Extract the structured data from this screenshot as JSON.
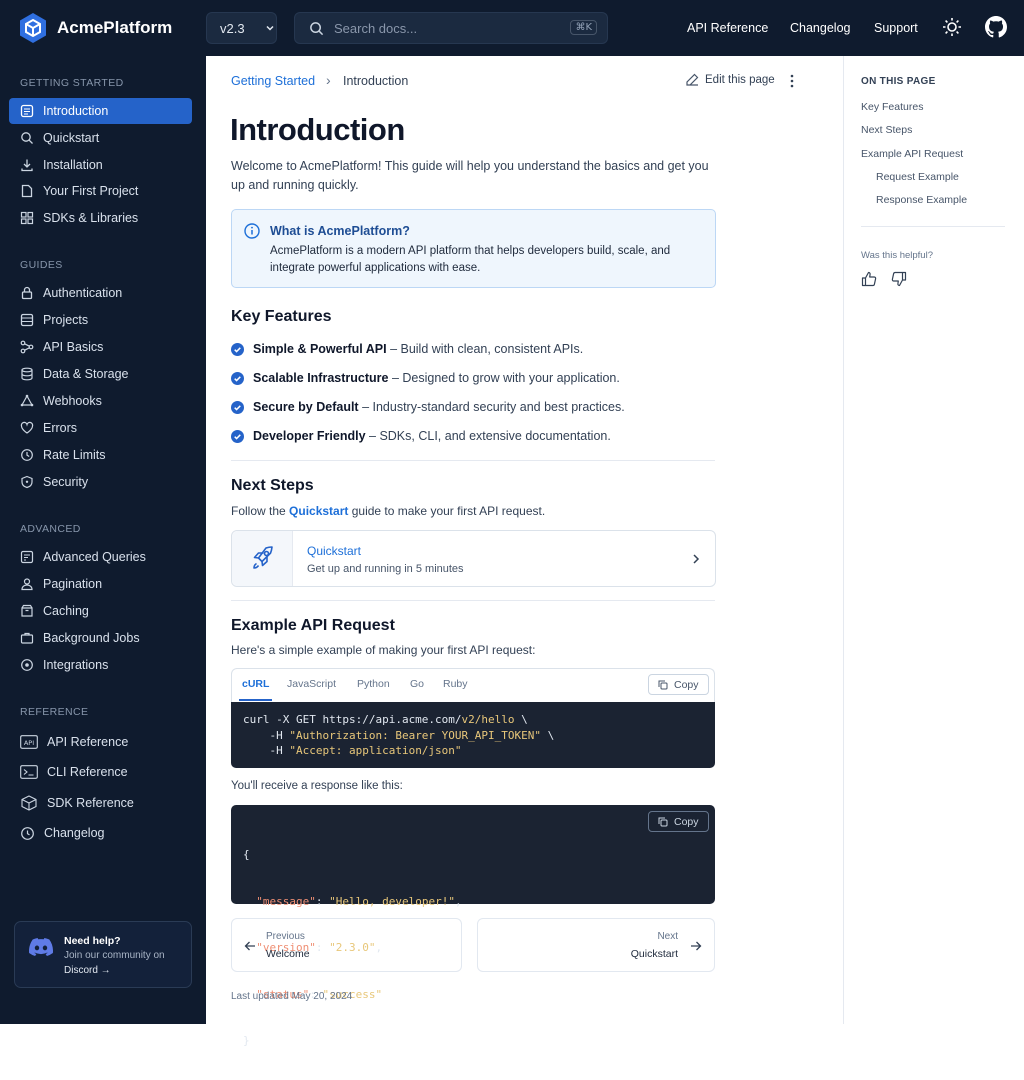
{
  "header": {
    "brand": "AcmePlatform",
    "version": "v2.3",
    "search_placeholder": "Search docs...",
    "search_shortcut": "⌘K",
    "links": [
      "API Reference",
      "Changelog",
      "Support"
    ]
  },
  "sidebar": {
    "sections": [
      {
        "title": "GETTING STARTED",
        "items": [
          "Introduction",
          "Quickstart",
          "Installation",
          "Your First Project",
          "SDKs & Libraries"
        ]
      },
      {
        "title": "GUIDES",
        "items": [
          "Authentication",
          "Projects",
          "API Basics",
          "Data & Storage",
          "Webhooks",
          "Errors",
          "Rate Limits",
          "Security"
        ]
      },
      {
        "title": "ADVANCED",
        "items": [
          "Advanced Queries",
          "Pagination",
          "Caching",
          "Background Jobs",
          "Integrations"
        ]
      },
      {
        "title": "REFERENCE",
        "items": [
          "API Reference",
          "CLI Reference",
          "SDK Reference",
          "Changelog"
        ]
      }
    ],
    "active_item": "Introduction",
    "help": {
      "title": "Need help?",
      "line1": "Join our community on",
      "line2": "Discord →"
    }
  },
  "breadcrumb": {
    "parent": "Getting Started",
    "separator": "›",
    "current": "Introduction"
  },
  "edit_label": "Edit this page",
  "page_title": "Introduction",
  "intro": "Welcome to AcmePlatform! This guide will help you understand the basics and get you up and running quickly.",
  "callout": {
    "title": "What is AcmePlatform?",
    "body": "AcmePlatform is a modern API platform that helps developers build, scale, and integrate powerful applications with ease."
  },
  "key_features": {
    "heading": "Key Features",
    "items": [
      {
        "title": "Simple & Powerful API",
        "desc": " – Build with clean, consistent APIs."
      },
      {
        "title": "Scalable Infrastructure",
        "desc": " – Designed to grow with your application."
      },
      {
        "title": "Secure by Default",
        "desc": " – Industry-standard security and best practices."
      },
      {
        "title": "Developer Friendly",
        "desc": " – SDKs, CLI, and extensive documentation."
      }
    ]
  },
  "next_steps": {
    "heading": "Next Steps",
    "text_before": "Follow the ",
    "link": "Quickstart",
    "text_after": " guide to make your first API request.",
    "card_title": "Quickstart",
    "card_desc": "Get up and running in 5 minutes"
  },
  "example": {
    "heading": "Example API Request",
    "intro": "Here's a simple example of making your first API request:",
    "tabs": [
      "cURL",
      "JavaScript",
      "Python",
      "Go",
      "Ruby"
    ],
    "active_tab": "cURL",
    "copy_label": "Copy",
    "request_lines": [
      {
        "pre": "curl -X GET https://api.acme.com/",
        "url_hl": "v2/hello",
        "post": " \\"
      },
      {
        "pre": "    -H ",
        "str": "\"Authorization: Bearer YOUR_API_TOKEN\"",
        "post": " \\"
      },
      {
        "pre": "    -H ",
        "str": "\"Accept: application/json\"",
        "post": ""
      }
    ],
    "response_intro": "You'll receive a response like this:",
    "response": {
      "open": "{",
      "rows": [
        {
          "key": "\"message\"",
          "val": "\"Hello, developer!\"",
          "comma": ","
        },
        {
          "key": "\"version\"",
          "val": "\"2.3.0\"",
          "comma": ","
        },
        {
          "key": "\"status\"",
          "val": "\"success\"",
          "comma": ""
        }
      ],
      "close": "}"
    }
  },
  "pager": {
    "prev_label": "Previous",
    "prev_title": "Welcome",
    "next_label": "Next",
    "next_title": "Quickstart"
  },
  "last_updated": "Last updated May 20, 2024",
  "toc": {
    "heading": "ON THIS PAGE",
    "items": [
      "Key Features",
      "Next Steps",
      "Example API Request",
      "Request Example",
      "Response Example"
    ],
    "helpful": "Was this helpful?"
  },
  "colors": {
    "nav_bg": "#0f1b2e",
    "accent": "#2563c9",
    "link": "#1d6fd8"
  }
}
